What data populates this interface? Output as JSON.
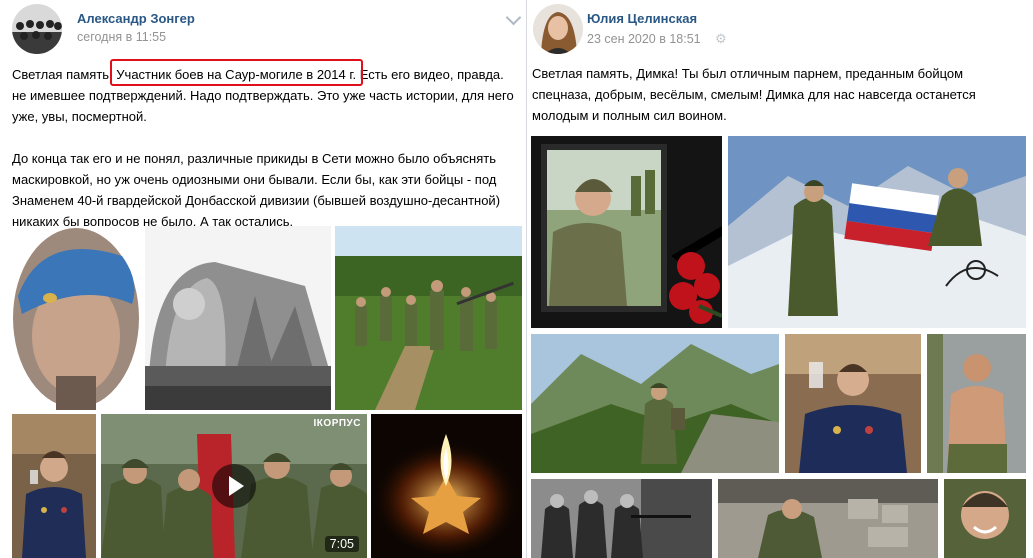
{
  "left_post": {
    "author": "Александр Зонгер",
    "date": "сегодня в 11:55",
    "text_line1_a": "Светлая память. ",
    "text_highlight": "Участник боев на Саур-могиле в 2014 г.",
    "text_line1_b": " Есть его видео, правда.",
    "text_rest": "не имевшее подтверждений. Надо подтверждать. Это уже часть истории, для него\nуже, увы, посмертной.\n\nДо конца так его и не понял, различные прикиды в Сети можно было объяснять\nмаскировкой, но уж очень одиозными они бывали. Если бы, как эти бойцы - под\nЗнаменем 40-й гвардейской Донбасской дивизии (бывшей воздушно-десантной)\nникаких бы вопросов не было. А так остались.",
    "video": {
      "duration": "7:05",
      "watermark": "IКОРПУС"
    }
  },
  "right_post": {
    "author": "Юлия Целинская",
    "date": "23 сен 2020 в 18:51",
    "text": "Светлая память, Димка! Ты был отличным парнем, преданным бойцом\nспецназа, добрым, весёлым, смелым! Димка для нас навсегда останется\nмолодым и полным сил воином."
  },
  "colors": {
    "author_link": "#2a5885",
    "date": "#939393",
    "highlight": "#e0101a",
    "divider": "#d8dbdf"
  },
  "icons": {
    "expand": "chevron-down-icon",
    "settings": "gear-icon",
    "play": "play-icon"
  }
}
